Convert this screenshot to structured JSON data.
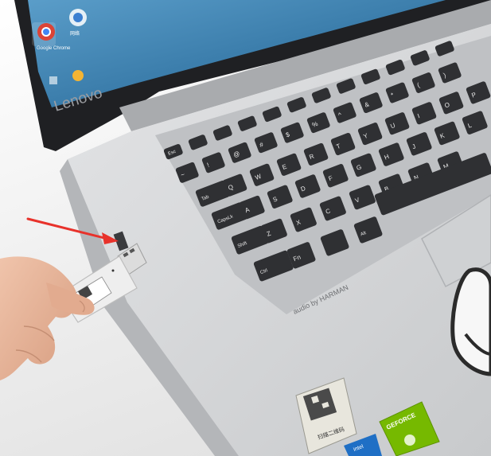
{
  "scene": {
    "description_colors": {
      "laptop_body": "#c9cbcd",
      "deck": "#d7d9db",
      "keys": "#2f3033",
      "key_text": "#e8e8e8",
      "screen_bezel": "#1e1f22",
      "screen": "#2a73a8",
      "arrow": "#e8322b",
      "usb_body": "#eeeeee",
      "skin": "#e9b89e",
      "nvidia_green": "#76b900",
      "intel_blue": "#1f6fc5"
    }
  },
  "laptop": {
    "brand": "Lenovo",
    "speaker_label": "audio by HARMAN"
  },
  "desktop_icons": [
    {
      "name": "chrome-icon",
      "label": "Google Chrome"
    },
    {
      "name": "network-icon",
      "label": "网络"
    }
  ],
  "keys": {
    "row_fn": [
      "Esc",
      "",
      "",
      "",
      "",
      "",
      "",
      "",
      "",
      "",
      "",
      ""
    ],
    "row_num": [
      "~",
      "!",
      "@",
      "#",
      "$",
      "%",
      "^",
      "&",
      "*",
      "(",
      ")"
    ],
    "row_q": [
      "Tab",
      "Q",
      "W",
      "E",
      "R",
      "T",
      "Y",
      "U",
      "I",
      "O",
      "P"
    ],
    "row_a": [
      "CapsLk",
      "A",
      "S",
      "D",
      "F",
      "G",
      "H",
      "J",
      "K",
      "L"
    ],
    "row_z": [
      "Shift",
      "Z",
      "X",
      "C",
      "V",
      "B",
      "N",
      "M"
    ],
    "row_bottom": [
      "Ctrl",
      "Fn",
      "",
      "Alt"
    ]
  },
  "stickers": {
    "qr_caption": "扫描二维码",
    "nvidia_text": "GEFORCE",
    "intel_text": "intel"
  }
}
